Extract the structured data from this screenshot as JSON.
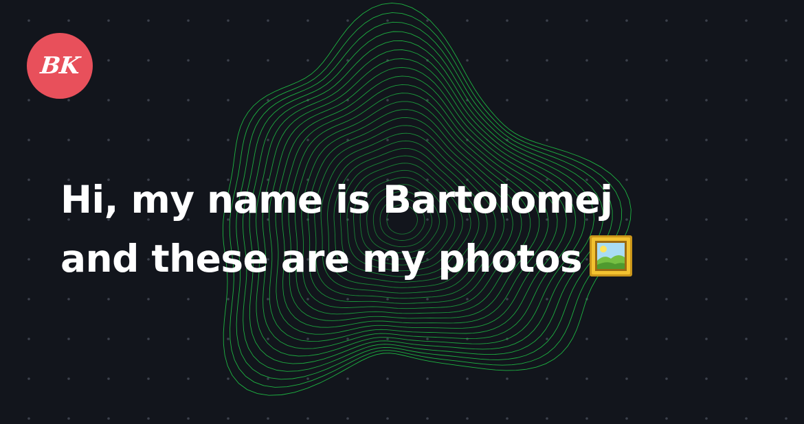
{
  "logo": {
    "text": "BK",
    "color": "#e8505b"
  },
  "hero": {
    "line1": "Hi, my name is Bartolomej",
    "line2": "and these are my photos",
    "emoji_icon": "framed-picture-icon"
  },
  "colors": {
    "background": "#12151c",
    "accent_lines": "#1fbf45",
    "text": "#ffffff",
    "dots": "#3c414c"
  }
}
